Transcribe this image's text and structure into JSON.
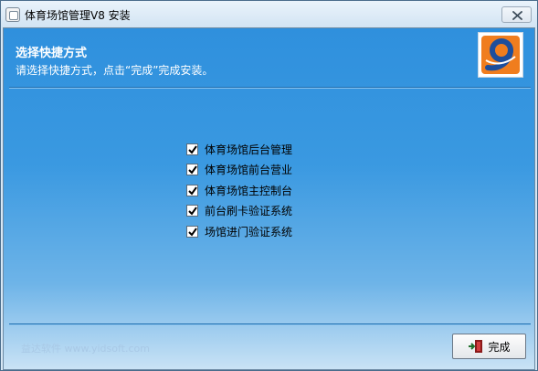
{
  "window": {
    "title": "体育场馆管理V8 安装"
  },
  "header": {
    "title": "选择快捷方式",
    "subtitle": "请选择快捷方式，点击“完成”完成安装。"
  },
  "options": [
    {
      "label": "体育场馆后台管理",
      "checked": true
    },
    {
      "label": "体育场馆前台营业",
      "checked": true
    },
    {
      "label": "体育场馆主控制台",
      "checked": true
    },
    {
      "label": "前台刷卡验证系统",
      "checked": true
    },
    {
      "label": "场馆进门验证系统",
      "checked": true
    }
  ],
  "footer": {
    "text": "益达软件 www.yidsoft.com",
    "finish_label": "完成"
  },
  "colors": {
    "accent": "#2f90dd",
    "logo_orange": "#f07d1e",
    "logo_blue": "#1d4e9c"
  },
  "icons": {
    "app": "installer-icon",
    "close": "close-icon",
    "logo": "brand-logo",
    "finish": "exit-door-icon"
  }
}
